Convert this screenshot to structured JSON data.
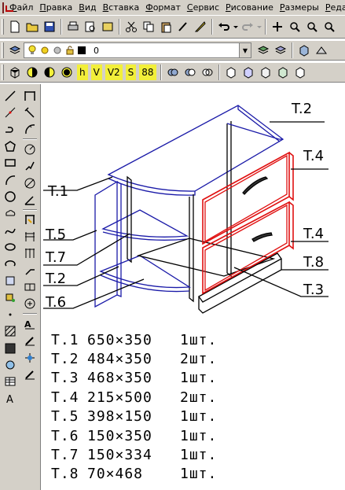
{
  "menu": [
    "Файл",
    "Правка",
    "Вид",
    "Вставка",
    "Формат",
    "Сервис",
    "Рисование",
    "Размеры",
    "Реда"
  ],
  "layer": {
    "name": "0"
  },
  "toolbar3_text_buttons": [
    "h",
    "V",
    "V2",
    "S",
    "88"
  ],
  "drawing_labels": {
    "t1": "T.1",
    "t2": "T.2",
    "t3": "T.3",
    "t4a": "T.4",
    "t4b": "T.4",
    "t5": "T.5",
    "t6": "T.6",
    "t7": "T.7",
    "t8": "T.8",
    "t2b": "T.2"
  },
  "parts": [
    {
      "label": "T.1",
      "dims": "650×350",
      "qty": "1шт."
    },
    {
      "label": "T.2",
      "dims": "484×350",
      "qty": "2шт."
    },
    {
      "label": "T.3",
      "dims": "468×350",
      "qty": "1шт."
    },
    {
      "label": "T.4",
      "dims": "215×500",
      "qty": "2шт."
    },
    {
      "label": "T.5",
      "dims": "398×150",
      "qty": "1шт."
    },
    {
      "label": "T.6",
      "dims": "150×350",
      "qty": "1шт."
    },
    {
      "label": "T.7",
      "dims": "150×334",
      "qty": "1шт."
    },
    {
      "label": "T.8",
      "dims": "70×468",
      "qty": "1шт."
    }
  ],
  "colors": {
    "panel_edge": "#1a1aa8",
    "drawer": "#e01010",
    "outline": "#000000",
    "ui_face": "#d4d0c8"
  }
}
